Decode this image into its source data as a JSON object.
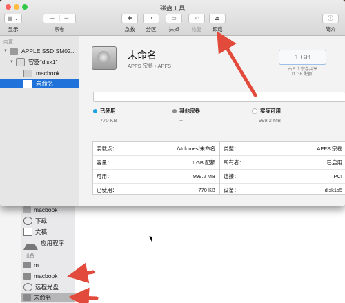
{
  "window": {
    "title": "磁盘工具"
  },
  "toolbar": {
    "display_label": "显示",
    "volume_label": "宗卷",
    "firstaid_label": "急救",
    "partition_label": "分区",
    "erase_label": "抹掉",
    "restore_label": "恢复",
    "unmount_label": "卸载",
    "info_label": "简介"
  },
  "sidebar": {
    "section": "内置",
    "disk": "APPLE SSD SM02...",
    "container": "容器“disk1”",
    "volumes": [
      "macbook",
      "未命名"
    ],
    "selected": "未命名"
  },
  "volume": {
    "name": "未命名",
    "subtitle": "APFS 宗卷 • APFS",
    "capacity": "1 GB",
    "capacity_note_1": "由 5 个宗卷共享",
    "capacity_note_2": "（1 GB 配额）"
  },
  "usage": {
    "used": {
      "label": "已使用",
      "value": "770 KB",
      "color": "#1ba1e2"
    },
    "other": {
      "label": "其他宗卷",
      "value": "--",
      "color": "#8c8c8c"
    },
    "free": {
      "label": "实际可用",
      "value": "999.2 MB",
      "color": "#ffffff"
    }
  },
  "info_left": [
    {
      "k": "装载点：",
      "v": "/Volumes/未命名"
    },
    {
      "k": "容量：",
      "v": "1 GB 配额"
    },
    {
      "k": "可用：",
      "v": "999.2 MB"
    },
    {
      "k": "已使用：",
      "v": "770 KB"
    }
  ],
  "info_right": [
    {
      "k": "类型：",
      "v": "APFS 宗卷"
    },
    {
      "k": "所有者：",
      "v": "已启用"
    },
    {
      "k": "连接：",
      "v": "PCI"
    },
    {
      "k": "设备：",
      "v": "disk1s5"
    }
  ],
  "finder": {
    "items": [
      "macbook",
      "下载",
      "文稿",
      "应用程序"
    ],
    "devices_header": "设备",
    "devices": [
      "m",
      "macbook",
      "远程光盘",
      "未命名"
    ]
  },
  "colors": {
    "accent": "#1e72d9",
    "arrow": "#e24a3b"
  }
}
